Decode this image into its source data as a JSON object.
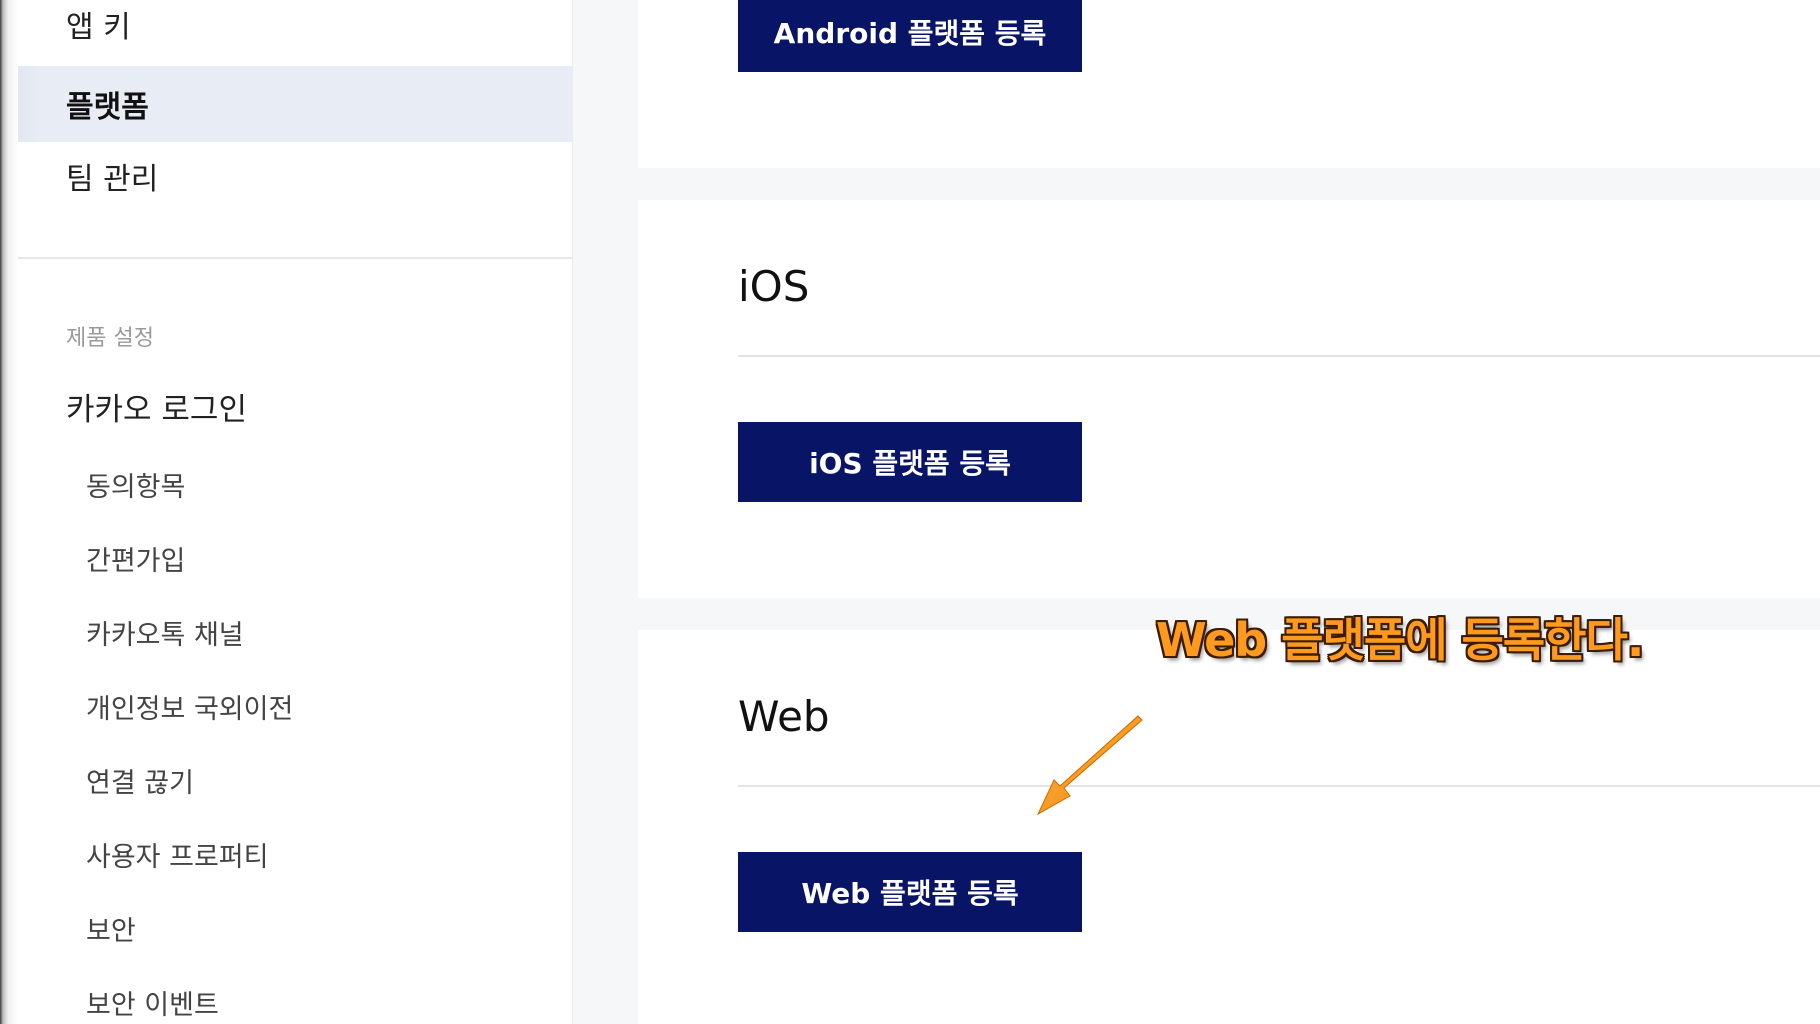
{
  "sidebar": {
    "top_items": [
      {
        "label": "앱 키",
        "active": false
      },
      {
        "label": "플랫폼",
        "active": true
      },
      {
        "label": "팀 관리",
        "active": false
      }
    ],
    "section_title": "제품 설정",
    "group_title": "카카오 로그인",
    "sub_items": [
      {
        "label": "동의항목"
      },
      {
        "label": "간편가입"
      },
      {
        "label": "카카오톡 채널"
      },
      {
        "label": "개인정보 국외이전"
      },
      {
        "label": "연결 끊기"
      },
      {
        "label": "사용자 프로퍼티"
      },
      {
        "label": "보안"
      },
      {
        "label": "보안 이벤트"
      }
    ]
  },
  "main": {
    "android": {
      "button_label": "Android 플랫폼 등록"
    },
    "ios": {
      "title": "iOS",
      "button_label": "iOS 플랫폼 등록"
    },
    "web": {
      "title": "Web",
      "button_label": "Web 플랫폼 등록"
    }
  },
  "annotation": {
    "text": "Web 플랫폼에 등록한다.",
    "color": "#ff9a1f"
  },
  "colors": {
    "button_bg": "#081466",
    "active_bg": "#e8ecf4",
    "band_bg": "#f6f7f8"
  }
}
